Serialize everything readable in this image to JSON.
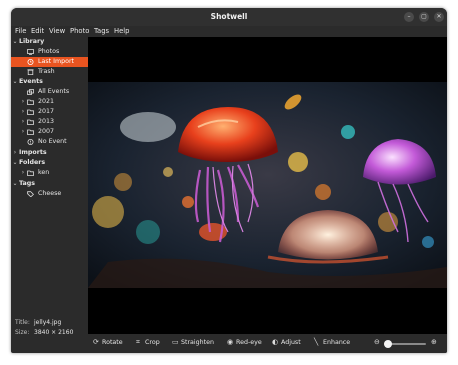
{
  "window": {
    "title": "Shotwell"
  },
  "menu": [
    "File",
    "Edit",
    "View",
    "Photo",
    "Tags",
    "Help"
  ],
  "sidebar": {
    "library": {
      "label": "Library",
      "items": [
        "Photos",
        "Last Import",
        "Trash"
      ],
      "selected": "Last Import"
    },
    "events": {
      "label": "Events",
      "items": [
        "All Events",
        "2021",
        "2017",
        "2013",
        "2007",
        "No Event"
      ]
    },
    "imports": {
      "label": "Imports"
    },
    "folders": {
      "label": "Folders",
      "items": [
        "ken"
      ]
    },
    "tags": {
      "label": "Tags",
      "items": [
        "Cheese"
      ]
    }
  },
  "info": {
    "title_label": "Title:",
    "title_value": "jelly4.jpg",
    "size_label": "Size:",
    "size_value": "3840 × 2160"
  },
  "toolbar": {
    "rotate": "Rotate",
    "crop": "Crop",
    "straighten": "Straighten",
    "red_eye": "Red-eye",
    "adjust": "Adjust",
    "enhance": "Enhance",
    "zoom_level": 0.1
  },
  "colors": {
    "accent": "#e95420",
    "window_bg": "#2b2b2b",
    "titlebar_bg": "#303030"
  }
}
